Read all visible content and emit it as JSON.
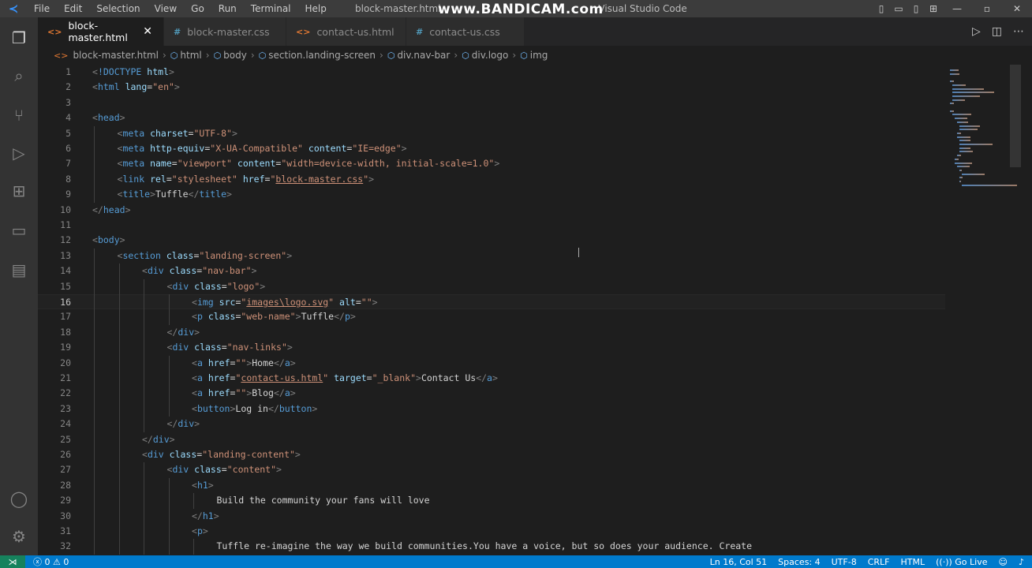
{
  "app": {
    "window_title": "block-master.html",
    "window_title_suffix": "Visual Studio Code",
    "watermark": "www.BANDICAM.com",
    "menu": [
      "File",
      "Edit",
      "Selection",
      "View",
      "Go",
      "Run",
      "Terminal",
      "Help"
    ]
  },
  "tabs": [
    {
      "label": "block-master.html",
      "icon": "html-file-icon",
      "active": true
    },
    {
      "label": "block-master.css",
      "icon": "css-file-icon",
      "active": false
    },
    {
      "label": "contact-us.html",
      "icon": "html-file-icon",
      "active": false
    },
    {
      "label": "contact-us.css",
      "icon": "css-file-icon",
      "active": false
    }
  ],
  "breadcrumb": [
    "block-master.html",
    "html",
    "body",
    "section.landing-screen",
    "div.nav-bar",
    "div.logo",
    "img"
  ],
  "editor": {
    "current_line": 16,
    "lines": [
      {
        "n": "1",
        "indent": 0,
        "tokens": [
          [
            "b",
            "<"
          ],
          [
            "t",
            "!DOCTYPE"
          ],
          [
            "x",
            " "
          ],
          [
            "a",
            "html"
          ],
          [
            "b",
            ">"
          ]
        ]
      },
      {
        "n": "2",
        "indent": 0,
        "tokens": [
          [
            "b",
            "<"
          ],
          [
            "t",
            "html"
          ],
          [
            "x",
            " "
          ],
          [
            "a",
            "lang"
          ],
          [
            "x",
            "="
          ],
          [
            "s",
            "\"en\""
          ],
          [
            "b",
            ">"
          ]
        ]
      },
      {
        "n": "3",
        "indent": 0,
        "tokens": []
      },
      {
        "n": "4",
        "indent": 0,
        "tokens": [
          [
            "b",
            "<"
          ],
          [
            "t",
            "head"
          ],
          [
            "b",
            ">"
          ]
        ]
      },
      {
        "n": "5",
        "indent": 1,
        "tokens": [
          [
            "b",
            "<"
          ],
          [
            "t",
            "meta"
          ],
          [
            "x",
            " "
          ],
          [
            "a",
            "charset"
          ],
          [
            "x",
            "="
          ],
          [
            "s",
            "\"UTF-8\""
          ],
          [
            "b",
            ">"
          ]
        ]
      },
      {
        "n": "6",
        "indent": 1,
        "tokens": [
          [
            "b",
            "<"
          ],
          [
            "t",
            "meta"
          ],
          [
            "x",
            " "
          ],
          [
            "a",
            "http-equiv"
          ],
          [
            "x",
            "="
          ],
          [
            "s",
            "\"X-UA-Compatible\""
          ],
          [
            "x",
            " "
          ],
          [
            "a",
            "content"
          ],
          [
            "x",
            "="
          ],
          [
            "s",
            "\"IE=edge\""
          ],
          [
            "b",
            ">"
          ]
        ]
      },
      {
        "n": "7",
        "indent": 1,
        "tokens": [
          [
            "b",
            "<"
          ],
          [
            "t",
            "meta"
          ],
          [
            "x",
            " "
          ],
          [
            "a",
            "name"
          ],
          [
            "x",
            "="
          ],
          [
            "s",
            "\"viewport\""
          ],
          [
            "x",
            " "
          ],
          [
            "a",
            "content"
          ],
          [
            "x",
            "="
          ],
          [
            "s",
            "\"width=device-width, initial-scale=1.0\""
          ],
          [
            "b",
            ">"
          ]
        ]
      },
      {
        "n": "8",
        "indent": 1,
        "tokens": [
          [
            "b",
            "<"
          ],
          [
            "t",
            "link"
          ],
          [
            "x",
            " "
          ],
          [
            "a",
            "rel"
          ],
          [
            "x",
            "="
          ],
          [
            "s",
            "\"stylesheet\""
          ],
          [
            "x",
            " "
          ],
          [
            "a",
            "href"
          ],
          [
            "x",
            "="
          ],
          [
            "s",
            "\""
          ],
          [
            "su",
            "block-master.css"
          ],
          [
            "s",
            "\""
          ],
          [
            "b",
            ">"
          ]
        ]
      },
      {
        "n": "9",
        "indent": 1,
        "tokens": [
          [
            "b",
            "<"
          ],
          [
            "t",
            "title"
          ],
          [
            "b",
            ">"
          ],
          [
            "x",
            "Tuffle"
          ],
          [
            "b",
            "</"
          ],
          [
            "t",
            "title"
          ],
          [
            "b",
            ">"
          ]
        ]
      },
      {
        "n": "10",
        "indent": 0,
        "tokens": [
          [
            "b",
            "</"
          ],
          [
            "t",
            "head"
          ],
          [
            "b",
            ">"
          ]
        ]
      },
      {
        "n": "11",
        "indent": 0,
        "tokens": []
      },
      {
        "n": "12",
        "indent": 0,
        "tokens": [
          [
            "b",
            "<"
          ],
          [
            "t",
            "body"
          ],
          [
            "b",
            ">"
          ]
        ]
      },
      {
        "n": "13",
        "indent": 1,
        "tokens": [
          [
            "b",
            "<"
          ],
          [
            "t",
            "section"
          ],
          [
            "x",
            " "
          ],
          [
            "a",
            "class"
          ],
          [
            "x",
            "="
          ],
          [
            "s",
            "\"landing-screen\""
          ],
          [
            "b",
            ">"
          ]
        ]
      },
      {
        "n": "14",
        "indent": 2,
        "tokens": [
          [
            "b",
            "<"
          ],
          [
            "t",
            "div"
          ],
          [
            "x",
            " "
          ],
          [
            "a",
            "class"
          ],
          [
            "x",
            "="
          ],
          [
            "s",
            "\"nav-bar\""
          ],
          [
            "b",
            ">"
          ]
        ]
      },
      {
        "n": "15",
        "indent": 3,
        "tokens": [
          [
            "b",
            "<"
          ],
          [
            "t",
            "div"
          ],
          [
            "x",
            " "
          ],
          [
            "a",
            "class"
          ],
          [
            "x",
            "="
          ],
          [
            "s",
            "\"logo\""
          ],
          [
            "b",
            ">"
          ]
        ]
      },
      {
        "n": "16",
        "indent": 4,
        "tokens": [
          [
            "b",
            "<"
          ],
          [
            "t",
            "img"
          ],
          [
            "x",
            " "
          ],
          [
            "a",
            "src"
          ],
          [
            "x",
            "="
          ],
          [
            "s",
            "\""
          ],
          [
            "su",
            "images\\logo.svg"
          ],
          [
            "s",
            "\""
          ],
          [
            "x",
            " "
          ],
          [
            "a",
            "alt"
          ],
          [
            "x",
            "="
          ],
          [
            "s",
            "\"\""
          ],
          [
            "b",
            ">"
          ]
        ]
      },
      {
        "n": "17",
        "indent": 4,
        "tokens": [
          [
            "b",
            "<"
          ],
          [
            "t",
            "p"
          ],
          [
            "x",
            " "
          ],
          [
            "a",
            "class"
          ],
          [
            "x",
            "="
          ],
          [
            "s",
            "\"web-name\""
          ],
          [
            "b",
            ">"
          ],
          [
            "x",
            "Tuffle"
          ],
          [
            "b",
            "</"
          ],
          [
            "t",
            "p"
          ],
          [
            "b",
            ">"
          ]
        ]
      },
      {
        "n": "18",
        "indent": 3,
        "tokens": [
          [
            "b",
            "</"
          ],
          [
            "t",
            "div"
          ],
          [
            "b",
            ">"
          ]
        ]
      },
      {
        "n": "19",
        "indent": 3,
        "tokens": [
          [
            "b",
            "<"
          ],
          [
            "t",
            "div"
          ],
          [
            "x",
            " "
          ],
          [
            "a",
            "class"
          ],
          [
            "x",
            "="
          ],
          [
            "s",
            "\"nav-links\""
          ],
          [
            "b",
            ">"
          ]
        ]
      },
      {
        "n": "20",
        "indent": 4,
        "tokens": [
          [
            "b",
            "<"
          ],
          [
            "t",
            "a"
          ],
          [
            "x",
            " "
          ],
          [
            "a",
            "href"
          ],
          [
            "x",
            "="
          ],
          [
            "s",
            "\"\""
          ],
          [
            "b",
            ">"
          ],
          [
            "x",
            "Home"
          ],
          [
            "b",
            "</"
          ],
          [
            "t",
            "a"
          ],
          [
            "b",
            ">"
          ]
        ]
      },
      {
        "n": "21",
        "indent": 4,
        "tokens": [
          [
            "b",
            "<"
          ],
          [
            "t",
            "a"
          ],
          [
            "x",
            " "
          ],
          [
            "a",
            "href"
          ],
          [
            "x",
            "="
          ],
          [
            "s",
            "\""
          ],
          [
            "su",
            "contact-us.html"
          ],
          [
            "s",
            "\""
          ],
          [
            "x",
            " "
          ],
          [
            "a",
            "target"
          ],
          [
            "x",
            "="
          ],
          [
            "s",
            "\"_blank\""
          ],
          [
            "b",
            ">"
          ],
          [
            "x",
            "Contact Us"
          ],
          [
            "b",
            "</"
          ],
          [
            "t",
            "a"
          ],
          [
            "b",
            ">"
          ]
        ]
      },
      {
        "n": "22",
        "indent": 4,
        "tokens": [
          [
            "b",
            "<"
          ],
          [
            "t",
            "a"
          ],
          [
            "x",
            " "
          ],
          [
            "a",
            "href"
          ],
          [
            "x",
            "="
          ],
          [
            "s",
            "\"\""
          ],
          [
            "b",
            ">"
          ],
          [
            "x",
            "Blog"
          ],
          [
            "b",
            "</"
          ],
          [
            "t",
            "a"
          ],
          [
            "b",
            ">"
          ]
        ]
      },
      {
        "n": "23",
        "indent": 4,
        "tokens": [
          [
            "b",
            "<"
          ],
          [
            "t",
            "button"
          ],
          [
            "b",
            ">"
          ],
          [
            "x",
            "Log in"
          ],
          [
            "b",
            "</"
          ],
          [
            "t",
            "button"
          ],
          [
            "b",
            ">"
          ]
        ]
      },
      {
        "n": "24",
        "indent": 3,
        "tokens": [
          [
            "b",
            "</"
          ],
          [
            "t",
            "div"
          ],
          [
            "b",
            ">"
          ]
        ]
      },
      {
        "n": "25",
        "indent": 2,
        "tokens": [
          [
            "b",
            "</"
          ],
          [
            "t",
            "div"
          ],
          [
            "b",
            ">"
          ]
        ]
      },
      {
        "n": "26",
        "indent": 2,
        "tokens": [
          [
            "b",
            "<"
          ],
          [
            "t",
            "div"
          ],
          [
            "x",
            " "
          ],
          [
            "a",
            "class"
          ],
          [
            "x",
            "="
          ],
          [
            "s",
            "\"landing-content\""
          ],
          [
            "b",
            ">"
          ]
        ]
      },
      {
        "n": "27",
        "indent": 3,
        "tokens": [
          [
            "b",
            "<"
          ],
          [
            "t",
            "div"
          ],
          [
            "x",
            " "
          ],
          [
            "a",
            "class"
          ],
          [
            "x",
            "="
          ],
          [
            "s",
            "\"content\""
          ],
          [
            "b",
            ">"
          ]
        ]
      },
      {
        "n": "28",
        "indent": 4,
        "tokens": [
          [
            "b",
            "<"
          ],
          [
            "t",
            "h1"
          ],
          [
            "b",
            ">"
          ]
        ]
      },
      {
        "n": "29",
        "indent": 5,
        "tokens": [
          [
            "x",
            "Build the community your fans will love"
          ]
        ]
      },
      {
        "n": "30",
        "indent": 4,
        "tokens": [
          [
            "b",
            "</"
          ],
          [
            "t",
            "h1"
          ],
          [
            "b",
            ">"
          ]
        ]
      },
      {
        "n": "31",
        "indent": 4,
        "tokens": [
          [
            "b",
            "<"
          ],
          [
            "t",
            "p"
          ],
          [
            "b",
            ">"
          ]
        ]
      },
      {
        "n": "32",
        "indent": 5,
        "tokens": [
          [
            "x",
            "Tuffle re-imagine the way we build communities.You have a voice, but so does your audience. Create"
          ]
        ]
      }
    ]
  },
  "statusbar": {
    "problems": "ⓧ 0 ⚠ 0",
    "position": "Ln 16, Col 51",
    "spaces": "Spaces: 4",
    "encoding": "UTF-8",
    "eol": "CRLF",
    "language": "HTML",
    "golive": "Go Live"
  },
  "colors": {
    "accent": "#007acc",
    "tag": "#569cd6",
    "attr": "#9cdcfe",
    "string": "#ce9178"
  }
}
